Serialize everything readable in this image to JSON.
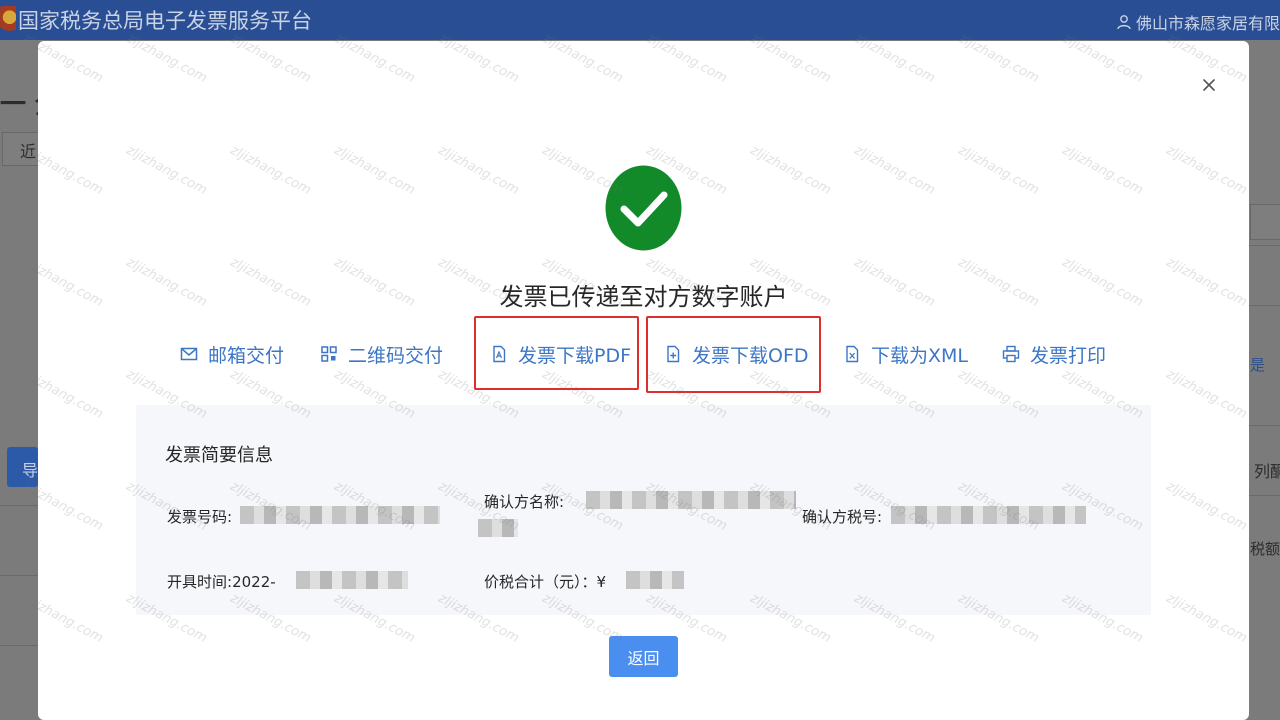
{
  "app": {
    "title": "国家税务总局电子发票服务平台",
    "user": "佛山市森愿家居有限"
  },
  "background_fragments": {
    "heading_fragment": "一 全",
    "select_fragment": "近",
    "button_fragment": "导",
    "right_1": "是",
    "right_2": "列酮",
    "right_3": "税额"
  },
  "modal": {
    "status_title": "发票已传递至对方数字账户",
    "actions": [
      {
        "label": "邮箱交付",
        "icon": "mail-icon"
      },
      {
        "label": "二维码交付",
        "icon": "qrcode-icon"
      },
      {
        "label": "发票下载PDF",
        "icon": "pdf-file-icon"
      },
      {
        "label": "发票下载OFD",
        "icon": "ofd-file-icon"
      },
      {
        "label": "下载为XML",
        "icon": "xml-file-icon"
      },
      {
        "label": "发票打印",
        "icon": "printer-icon"
      }
    ],
    "highlight_color": "#df2d2d",
    "info": {
      "heading": "发票简要信息",
      "invoice_number_label": "发票号码:",
      "confirm_name_label": "确认方名称:",
      "confirm_tax_label": "确认方税号:",
      "issue_time_label": "开具时间:",
      "issue_time_value": "2022-",
      "total_label": "价税合计（元）：",
      "total_currency": "¥"
    },
    "return_label": "返回"
  },
  "colors": {
    "header": "#2a4e93",
    "accent": "#3d76c6",
    "success": "#138a2a",
    "button": "#4a8ef0"
  },
  "watermark": "zljizhang.com"
}
